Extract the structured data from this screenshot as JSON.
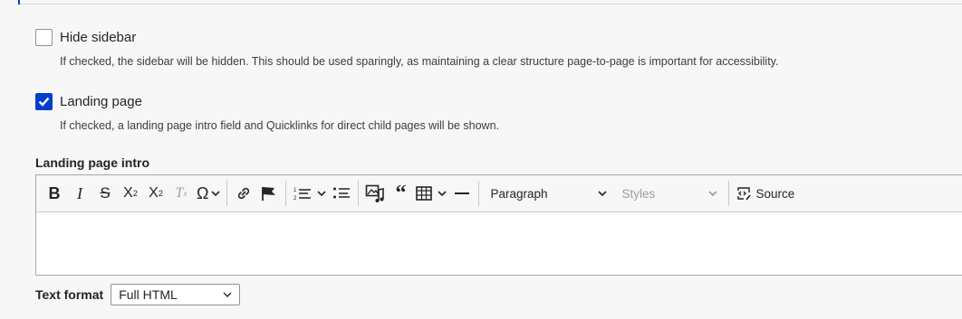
{
  "hide_sidebar": {
    "label": "Hide sidebar",
    "checked": false,
    "description": "If checked, the sidebar will be hidden. This should be used sparingly, as maintaining a clear structure page-to-page is important for accessibility."
  },
  "landing_page": {
    "label": "Landing page",
    "checked": true,
    "description": "If checked, a landing page intro field and Quicklinks for direct child pages will be shown."
  },
  "intro_field": {
    "label": "Landing page intro"
  },
  "toolbar": {
    "heading_dropdown": "Paragraph",
    "styles_dropdown": "Styles",
    "source_label": "Source",
    "icons": [
      "bold-icon",
      "italic-icon",
      "strikethrough-icon",
      "subscript-icon",
      "superscript-icon",
      "remove-format-icon",
      "special-characters-icon",
      "link-icon",
      "anchor-flag-icon",
      "numbered-list-icon",
      "bulleted-list-icon",
      "media-icon",
      "blockquote-icon",
      "table-icon",
      "horizontal-line-icon",
      "source-icon"
    ]
  },
  "text_format": {
    "label": "Text format",
    "selected": "Full HTML"
  },
  "colors": {
    "accent": "#003ecc"
  }
}
